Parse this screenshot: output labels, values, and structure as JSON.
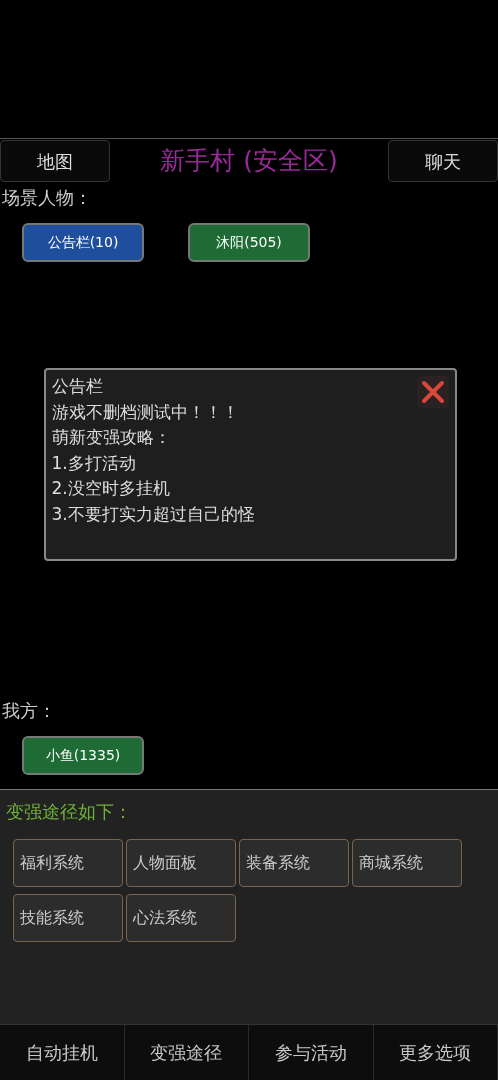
{
  "header": {
    "left_button": "地图",
    "title": "新手村 (安全区)",
    "right_button": "聊天"
  },
  "scene": {
    "label": "场景人物：",
    "characters": [
      {
        "name": "公告栏(10)",
        "color": "#1f4e9c"
      },
      {
        "name": "沐阳(505)",
        "color": "#1e6b35"
      }
    ]
  },
  "notice": {
    "title": "公告栏",
    "lines": [
      "游戏不删档测试中！！！",
      "萌新变强攻略：",
      "1.多打活动",
      "2.没空时多挂机",
      "3.不要打实力超过自己的怪"
    ]
  },
  "own_side": {
    "label": "我方：",
    "characters": [
      {
        "name": "小鱼(1335)",
        "color": "#1e6b35"
      }
    ]
  },
  "paths": {
    "heading": "变强途径如下：",
    "buttons": [
      "福利系统",
      "人物面板",
      "装备系统",
      "商城系统",
      "技能系统",
      "心法系统"
    ]
  },
  "bottom_tabs": [
    "自动挂机",
    "变强途径",
    "参与活动",
    "更多选项"
  ]
}
